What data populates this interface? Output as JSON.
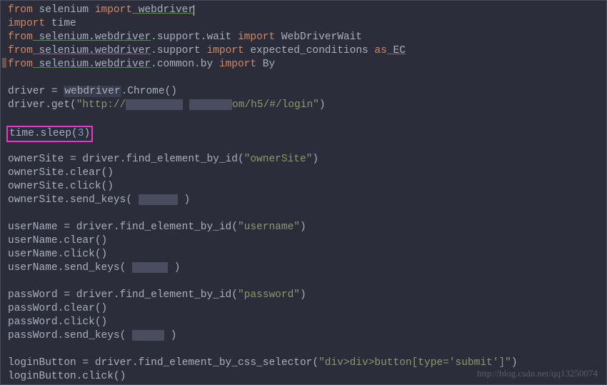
{
  "code": {
    "l1_from": "from",
    "l1_sel": " selenium ",
    "l1_imp": "import",
    "l1_wd": " webdriver",
    "l2_imp": "import",
    "l2_time": " time",
    "l3_from": "from",
    "l3_path": " selenium.webdriver",
    "l3_sup": ".support.wait ",
    "l3_imp": "import",
    "l3_wdw": " WebDriverWait",
    "l4_from": "from",
    "l4_path": " selenium.webdriver",
    "l4_sup": ".support ",
    "l4_imp": "import",
    "l4_ec": " expected_conditions ",
    "l4_as": "as",
    "l4_eca": " EC",
    "l5_from": "from",
    "l5_path": " selenium.webdriver",
    "l5_sup": ".common.by ",
    "l5_imp": "import",
    "l5_by": " By",
    "l7": "driver = ",
    "l7_wd": "webdriver",
    "l7_chr": ".Chrome()",
    "l8": "driver.get(",
    "l8_s1": "\"http://",
    "l8_s2": "om/h5/#/login\"",
    "l8_end": ")",
    "l10_time": "time",
    "l10_sleep": ".sleep(",
    "l10_n": "3",
    "l10_end": ")",
    "l12": "ownerSite = driver.find_element_by_id(",
    "l12_s": "\"ownerSite\"",
    "l12_e": ")",
    "l13": "ownerSite.clear()",
    "l14": "ownerSite.click()",
    "l15": "ownerSite.send_keys(",
    "l15_e": ")",
    "l17": "userName = driver.find_element_by_id(",
    "l17_s": "\"username\"",
    "l17_e": ")",
    "l18": "userName.clear()",
    "l19": "userName.click()",
    "l20": "userName.send_keys(",
    "l20_e": ")",
    "l22": "passWord = driver.find_element_by_id(",
    "l22_s": "\"password\"",
    "l22_e": ")",
    "l23": "passWord.clear()",
    "l24": "passWord.click()",
    "l25": "passWord.send_keys(",
    "l25_e": ")",
    "l27": "loginButton = driver.find_element_by_css_selector(",
    "l27_s": "\"div>div>button[type='submit']\"",
    "l27_e": ")",
    "l28": "loginButton.click()"
  },
  "watermark": "http://blog.csdn.net/qq13250074"
}
